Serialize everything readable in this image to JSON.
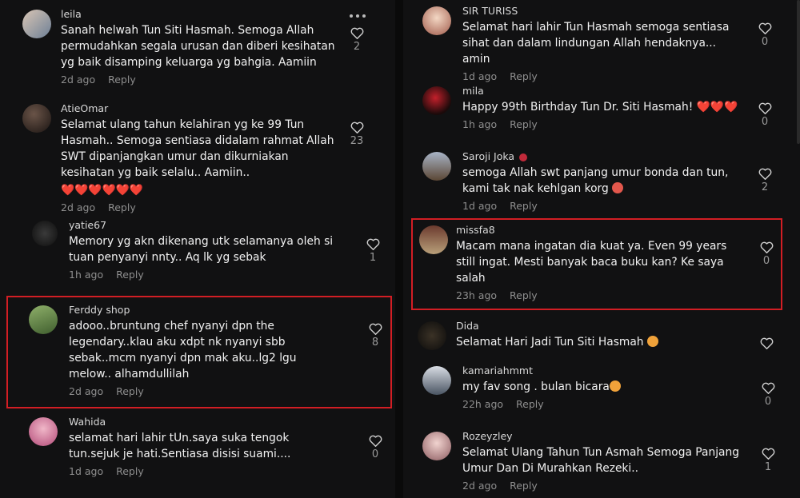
{
  "left": [
    {
      "user": "leila",
      "text": "Sanah helwah Tun Siti Hasmah. Semoga Allah permudahkan segala urusan dan diberi kesihatan yg baik disamping keluarga yg bahgia. Aamiin",
      "time": "2d ago",
      "reply": "Reply",
      "likes": "2"
    },
    {
      "user": "AtieOmar",
      "text": "Selamat ulang tahun kelahiran yg ke 99 Tun Hasmah.. Semoga sentiasa didalam rahmat Allah SWT dipanjangkan umur dan dikurniakan kesihatan yg baik selalu.. Aamiin..",
      "emoji": "❤️❤️❤️❤️❤️❤️",
      "time": "2d ago",
      "reply": "Reply",
      "likes": "23"
    },
    {
      "user": "yatie67",
      "text": "Memory yg akn dikenang utk selamanya oleh si tuan penyanyi nnty.. Aq lk yg sebak",
      "time": "1h ago",
      "reply": "Reply",
      "likes": "1"
    },
    {
      "user": "Ferddy shop",
      "text": "adooo..bruntung chef nyanyi dpn the legendary..klau aku xdpt nk nyanyi sbb sebak..mcm nyanyi dpn mak aku..lg2 lgu melow.. alhamdullilah",
      "time": "2d ago",
      "reply": "Reply",
      "likes": "8"
    },
    {
      "user": "Wahida",
      "text": "selamat hari lahir tUn.saya suka tengok tun.sejuk je hati.Sentiasa disisi suami....",
      "time": "1d ago",
      "reply": "Reply",
      "likes": "0"
    }
  ],
  "right": [
    {
      "user": "SIR TURISS",
      "text": "Selamat hari lahir Tun Hasmah semoga sentiasa sihat dan dalam lindungan Allah hendaknya... amin",
      "time": "1d ago",
      "reply": "Reply",
      "likes": "0"
    },
    {
      "user": "mila",
      "text": "Happy 99th Birthday Tun Dr. Siti Hasmah!",
      "emoji": "❤️❤️❤️",
      "time": "1h ago",
      "reply": "Reply",
      "likes": "0"
    },
    {
      "user": "Saroji Joka",
      "text": "semoga Allah swt panjang umur bonda dan tun, kami tak nak kehlgan korg",
      "time": "1d ago",
      "reply": "Reply",
      "likes": "2"
    },
    {
      "user": "missfa8",
      "text": "Macam mana ingatan dia kuat ya. Even 99 years still ingat. Mesti banyak baca buku kan? Ke saya salah",
      "time": "23h ago",
      "reply": "Reply",
      "likes": "0"
    },
    {
      "user": "Dida",
      "text": "Selamat Hari Jadi Tun Siti Hasmah",
      "time": "",
      "reply": "",
      "likes": ""
    },
    {
      "user": "kamariahmmt",
      "text": "my fav song . bulan bicara",
      "time": "22h ago",
      "reply": "Reply",
      "likes": "0"
    },
    {
      "user": "Rozeyzley",
      "text": "Selamat Ulang Tahun Tun Asmah Semoga Panjang Umur Dan Di Murahkan Rezeki..",
      "time": "2d ago",
      "reply": "Reply",
      "likes": "1"
    }
  ],
  "icons": {
    "like": "heart-outline-icon",
    "more": "more-dots-icon"
  },
  "colors": {
    "background": "#111112",
    "highlight": "#d21e24",
    "meta": "#8e8e8e"
  }
}
